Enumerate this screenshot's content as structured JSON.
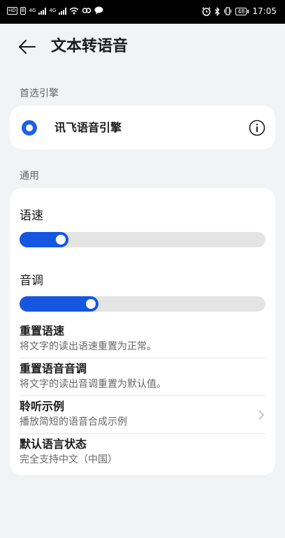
{
  "status_bar": {
    "hd_badge": "HD",
    "sim_badge": "B",
    "network_labels": [
      "4G",
      "4G"
    ],
    "time": "17:05",
    "battery": "48"
  },
  "header": {
    "title": "文本转语音"
  },
  "preferred_engine": {
    "section_label": "首选引擎",
    "engine_name": "讯飞语音引擎",
    "selected": true
  },
  "general": {
    "section_label": "通用",
    "speech_rate": {
      "label": "语速",
      "value_fraction": 0.2
    },
    "pitch": {
      "label": "音调",
      "value_fraction": 0.32
    },
    "rows": [
      {
        "title": "重置语速",
        "subtitle": "将文字的读出语速重置为正常。",
        "chevron": false
      },
      {
        "title": "重置语音音调",
        "subtitle": "将文字的读出音调重置为默认值。",
        "chevron": false
      },
      {
        "title": "聆听示例",
        "subtitle": "播放简短的语音合成示例",
        "chevron": true
      },
      {
        "title": "默认语言状态",
        "subtitle": "完全支持中文（中国）",
        "chevron": false
      }
    ]
  },
  "colors": {
    "accent": "#1656e0",
    "background": "#f1f3f5",
    "card": "#ffffff",
    "track": "#e4e4e4"
  }
}
